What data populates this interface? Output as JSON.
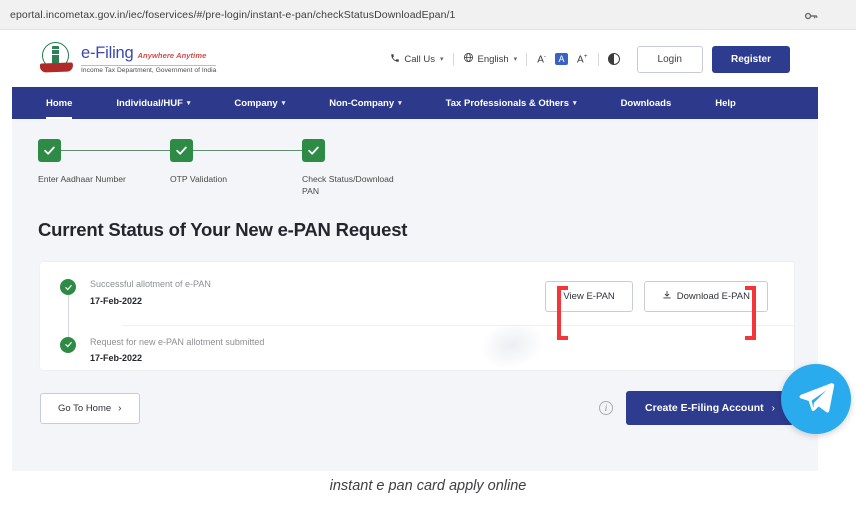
{
  "browser": {
    "url": "eportal.incometax.gov.in/iec/foservices/#/pre-login/instant-e-pan/checkStatusDownloadEpan/1",
    "key_icon": "key-icon"
  },
  "header": {
    "brand_name": "e-Filing",
    "brand_tagline": "Anywhere Anytime",
    "brand_subtitle": "Income Tax Department, Government of India",
    "emblem_icon": "india-emblem-icon",
    "tools": {
      "call_us": "Call Us",
      "call_icon": "phone-icon",
      "language": "English",
      "globe_icon": "globe-icon",
      "font_decrease": "A",
      "font_decrease_sup": "-",
      "font_normal": "A",
      "font_increase": "A",
      "font_increase_sup": "+",
      "contrast_icon": "contrast-icon"
    },
    "login_label": "Login",
    "register_label": "Register"
  },
  "nav": {
    "items": [
      {
        "label": "Home",
        "has_caret": false,
        "active": true
      },
      {
        "label": "Individual/HUF",
        "has_caret": true,
        "active": false
      },
      {
        "label": "Company",
        "has_caret": true,
        "active": false
      },
      {
        "label": "Non-Company",
        "has_caret": true,
        "active": false
      },
      {
        "label": "Tax Professionals & Others",
        "has_caret": true,
        "active": false
      },
      {
        "label": "Downloads",
        "has_caret": false,
        "active": false
      },
      {
        "label": "Help",
        "has_caret": false,
        "active": false
      }
    ]
  },
  "stepper": {
    "steps": [
      {
        "label": "Enter Aadhaar Number",
        "state": "complete",
        "icon": "check-icon"
      },
      {
        "label": "OTP Validation",
        "state": "complete",
        "icon": "check-icon"
      },
      {
        "label": "Check Status/Download PAN",
        "state": "complete",
        "icon": "check-icon"
      }
    ]
  },
  "main": {
    "page_title": "Current Status of Your New e-PAN Request",
    "timeline": [
      {
        "title": "Successful allotment of e-PAN",
        "date": "17-Feb-2022",
        "icon": "check-circle-icon"
      },
      {
        "title": "Request for new e-PAN allotment submitted",
        "date": "17-Feb-2022",
        "icon": "check-circle-icon"
      }
    ],
    "actions": {
      "view_epan": "View E-PAN",
      "download_epan": "Download E-PAN",
      "download_icon": "download-icon"
    },
    "annotation_color": "#f4353a"
  },
  "footer_bar": {
    "go_to_home": "Go To Home",
    "go_to_home_chevron": "›",
    "info_icon": "info-icon",
    "info_glyph": "i",
    "create_account": "Create E-Filing Account",
    "create_account_chevron": "›"
  },
  "floating": {
    "telegram_icon": "telegram-icon"
  },
  "caption": "instant e pan card apply online",
  "colors": {
    "nav_blue": "#2d3a8c",
    "primary_blue": "#2e3c8f",
    "green": "#2e8b45",
    "annotation_red": "#f4353a",
    "telegram_blue": "#2aabee",
    "page_bg": "#f4f5f8"
  }
}
